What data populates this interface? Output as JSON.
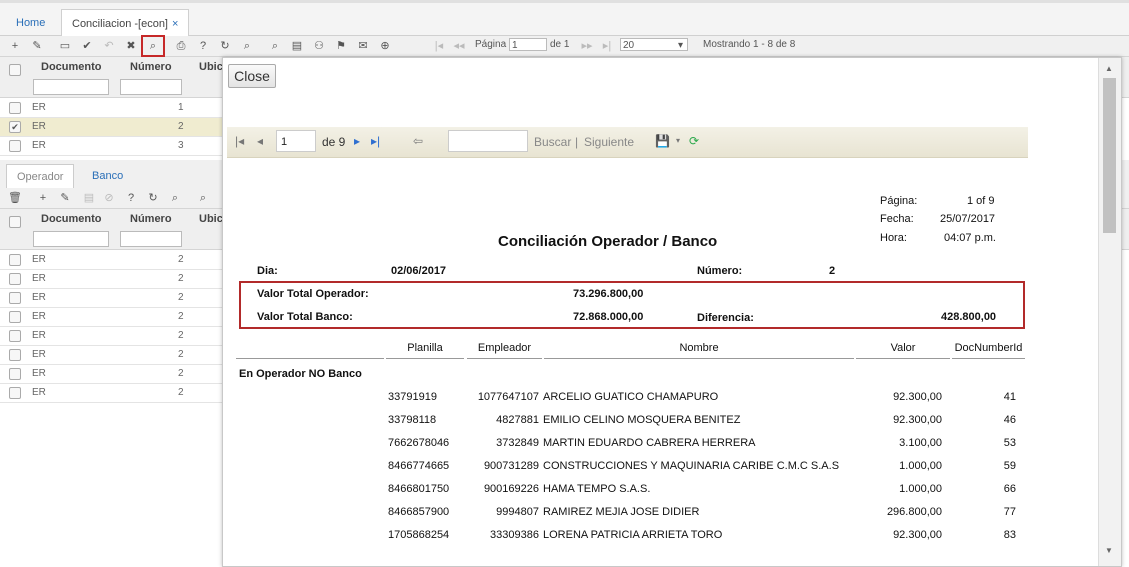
{
  "tabs": {
    "home": "Home",
    "active": "Conciliacion -[econ]",
    "close": "×"
  },
  "toolbar": {
    "page_label": "Página",
    "page_value": "1",
    "of_label": "de 1",
    "page_size": "20",
    "showing": "Mostrando 1 - 8 de 8"
  },
  "grid": {
    "headers": [
      "Documento",
      "Número",
      "Ubic"
    ],
    "rows": [
      {
        "doc": "ER",
        "num": "1",
        "checked": false
      },
      {
        "doc": "ER",
        "num": "2",
        "checked": true
      },
      {
        "doc": "ER",
        "num": "3",
        "checked": false
      }
    ]
  },
  "subtabs": {
    "operador": "Operador",
    "banco": "Banco"
  },
  "subgrid": {
    "headers": [
      "Documento",
      "Número",
      "Ubic"
    ],
    "rows": [
      {
        "doc": "ER",
        "num": "2"
      },
      {
        "doc": "ER",
        "num": "2"
      },
      {
        "doc": "ER",
        "num": "2"
      },
      {
        "doc": "ER",
        "num": "2"
      },
      {
        "doc": "ER",
        "num": "2"
      },
      {
        "doc": "ER",
        "num": "2"
      },
      {
        "doc": "ER",
        "num": "2"
      },
      {
        "doc": "ER",
        "num": "2"
      }
    ]
  },
  "modal": {
    "close": "Close",
    "page_input": "1",
    "of_pages": "de 9",
    "search_label": "Buscar",
    "separator": "|",
    "next_label": "Siguiente"
  },
  "report": {
    "meta": {
      "pagina_label": "Página:",
      "pagina_value": "1 of 9",
      "fecha_label": "Fecha:",
      "fecha_value": "25/07/2017",
      "hora_label": "Hora:",
      "hora_value": "04:07 p.m."
    },
    "title": "Conciliación Operador / Banco",
    "dia_label": "Dia:",
    "dia_value": "02/06/2017",
    "numero_label": "Número:",
    "numero_value": "2",
    "total_operador_label": "Valor Total Operador:",
    "total_operador_value": "73.296.800,00",
    "total_banco_label": "Valor Total Banco:",
    "total_banco_value": "72.868.000,00",
    "diferencia_label": "Diferencia:",
    "diferencia_value": "428.800,00",
    "columns": [
      "Planilla",
      "Empleador",
      "Nombre",
      "Valor",
      "DocNumberId"
    ],
    "section": "En Operador NO Banco",
    "rows": [
      {
        "planilla": "33791919",
        "empleador": "1077647107",
        "nombre": "ARCELIO GUATICO CHAMAPURO",
        "valor": "92.300,00",
        "doc": "41"
      },
      {
        "planilla": "33798118",
        "empleador": "4827881",
        "nombre": "EMILIO CELINO MOSQUERA BENITEZ",
        "valor": "92.300,00",
        "doc": "46"
      },
      {
        "planilla": "7662678046",
        "empleador": "3732849",
        "nombre": "MARTIN EDUARDO CABRERA HERRERA",
        "valor": "3.100,00",
        "doc": "53"
      },
      {
        "planilla": "8466774665",
        "empleador": "900731289",
        "nombre": "CONSTRUCCIONES Y MAQUINARIA CARIBE C.M.C S.A.S",
        "valor": "1.000,00",
        "doc": "59"
      },
      {
        "planilla": "8466801750",
        "empleador": "900169226",
        "nombre": "HAMA TEMPO S.A.S.",
        "valor": "1.000,00",
        "doc": "66"
      },
      {
        "planilla": "8466857900",
        "empleador": "9994807",
        "nombre": "RAMIREZ MEJIA JOSE DIDIER",
        "valor": "296.800,00",
        "doc": "77"
      },
      {
        "planilla": "1705868254",
        "empleador": "33309386",
        "nombre": "LORENA PATRICIA ARRIETA TORO",
        "valor": "92.300,00",
        "doc": "83"
      }
    ]
  }
}
